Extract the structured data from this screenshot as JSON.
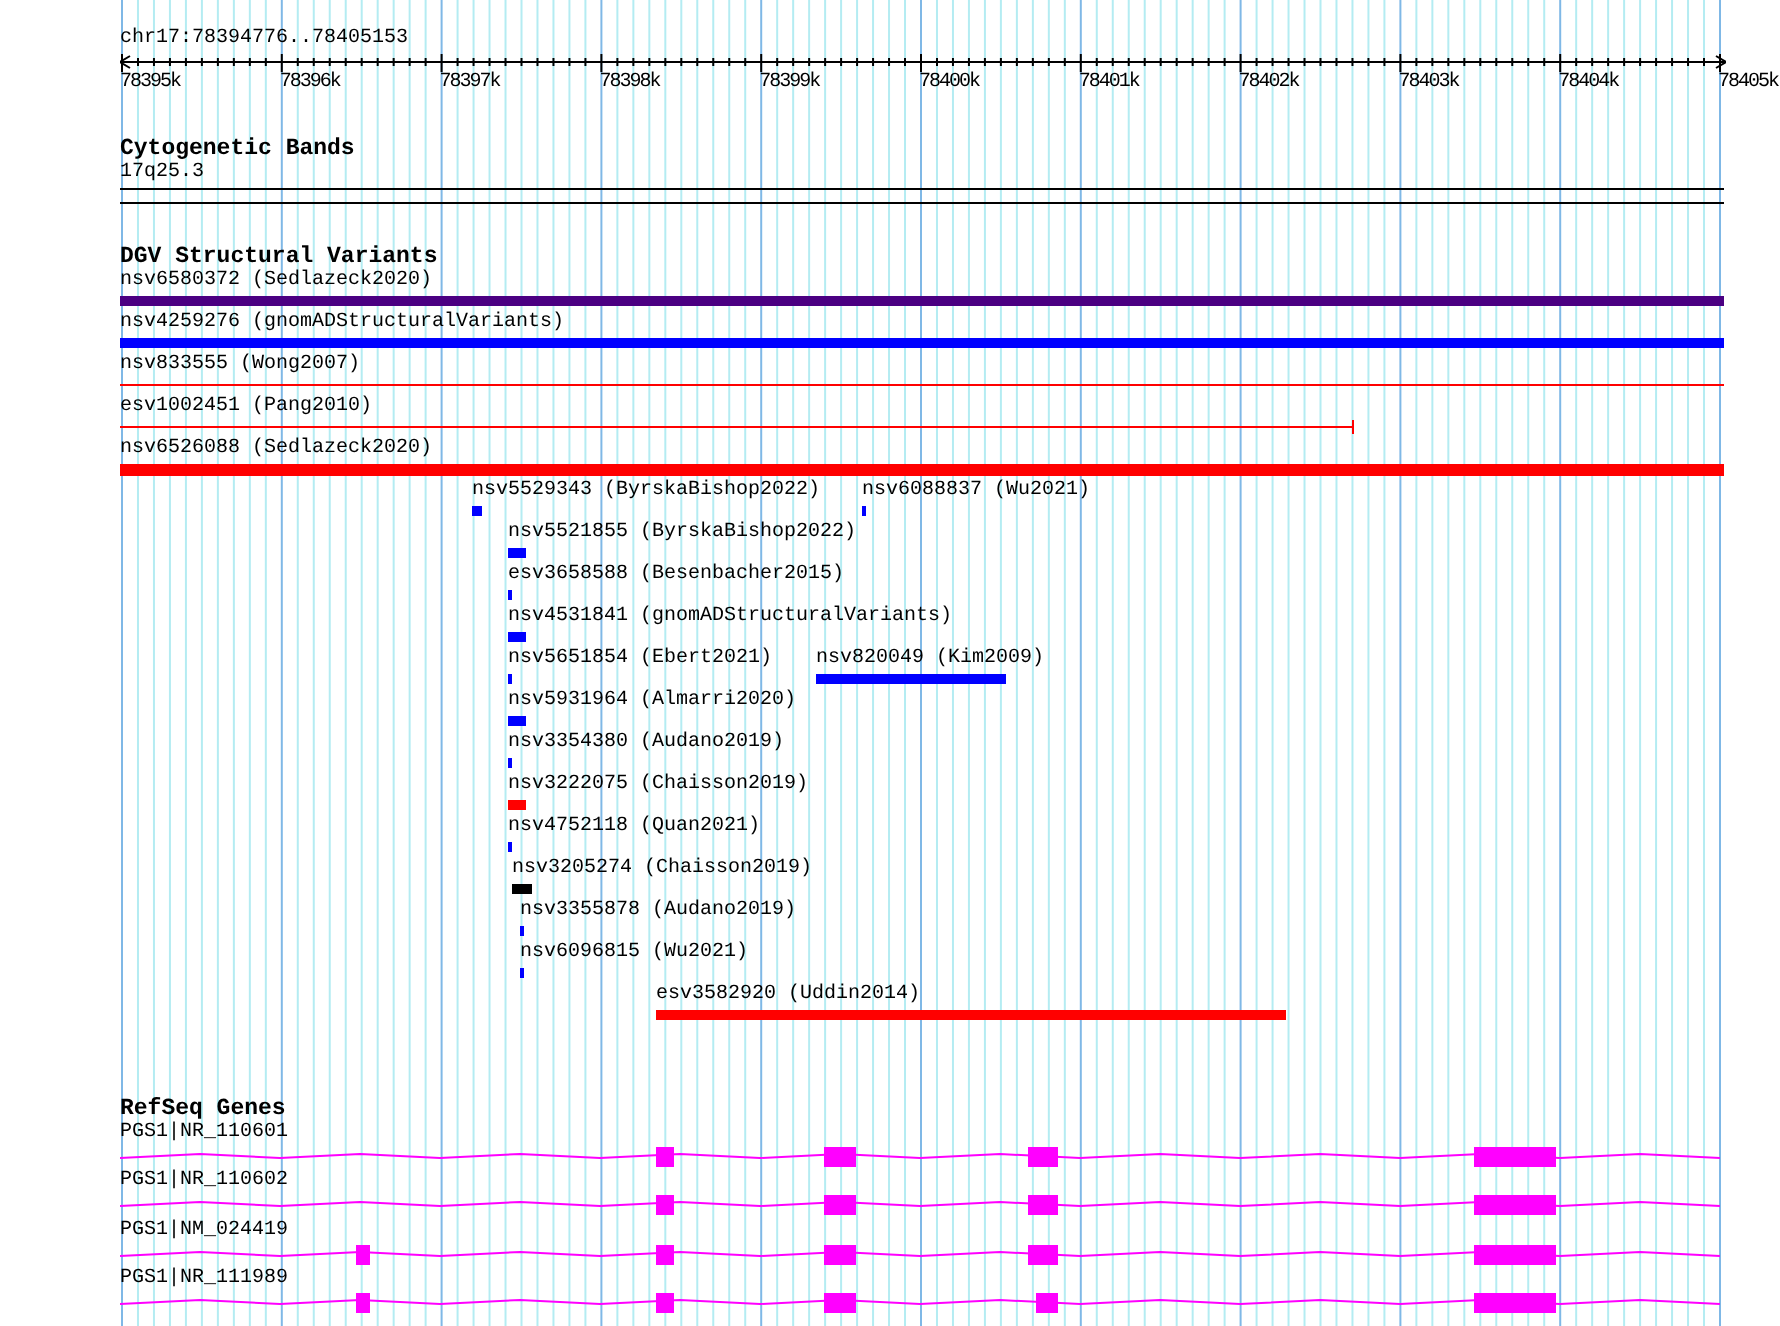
{
  "ruler": {
    "location": "chr17:78394776..78405153",
    "ticks": [
      "78395k",
      "78396k",
      "78397k",
      "78398k",
      "78399k",
      "78400k",
      "78401k",
      "78402k",
      "78403k",
      "78404k",
      "78405k"
    ]
  },
  "tracks": [
    {
      "title": "Cytogenetic Bands",
      "kind": "bands",
      "features": [
        {
          "label": "17q25.3"
        }
      ]
    },
    {
      "title": "DGV Structural Variants",
      "kind": "variants",
      "features": [
        {
          "label": "nsv6580372 (Sedlazeck2020)",
          "color": "#4b0082"
        },
        {
          "label": "nsv4259276 (gnomADStructuralVariants)",
          "color": "#0000ff"
        },
        {
          "label": "nsv833555 (Wong2007)",
          "color": "#ff0000"
        },
        {
          "label": "esv1002451 (Pang2010)",
          "color": "#ff0000"
        },
        {
          "label": "nsv6526088 (Sedlazeck2020)",
          "color": "#ff0000"
        },
        {
          "label": "nsv5529343 (ByrskaBishop2022)",
          "color": "#0000ff"
        },
        {
          "label": "nsv6088837 (Wu2021)",
          "color": "#0000ff"
        },
        {
          "label": "nsv5521855 (ByrskaBishop2022)",
          "color": "#0000ff"
        },
        {
          "label": "esv3658588 (Besenbacher2015)",
          "color": "#0000ff"
        },
        {
          "label": "nsv4531841 (gnomADStructuralVariants)",
          "color": "#0000ff"
        },
        {
          "label": "nsv5651854 (Ebert2021)",
          "color": "#0000ff"
        },
        {
          "label": "nsv820049 (Kim2009)",
          "color": "#0000ff"
        },
        {
          "label": "nsv5931964 (Almarri2020)",
          "color": "#0000ff"
        },
        {
          "label": "nsv3354380 (Audano2019)",
          "color": "#0000ff"
        },
        {
          "label": "nsv3222075 (Chaisson2019)",
          "color": "#ff0000"
        },
        {
          "label": "nsv4752118 (Quan2021)",
          "color": "#0000ff"
        },
        {
          "label": "nsv3205274 (Chaisson2019)",
          "color": "#000000"
        },
        {
          "label": "nsv3355878 (Audano2019)",
          "color": "#0000ff"
        },
        {
          "label": "nsv6096815 (Wu2021)",
          "color": "#0000ff"
        },
        {
          "label": "esv3582920 (Uddin2014)",
          "color": "#ff0000"
        }
      ]
    },
    {
      "title": "RefSeq Genes",
      "kind": "genes",
      "features": [
        {
          "label": "PGS1|NR_110601"
        },
        {
          "label": "PGS1|NR_110602"
        },
        {
          "label": "PGS1|NM_024419"
        },
        {
          "label": "PGS1|NR_111989"
        }
      ]
    }
  ]
}
